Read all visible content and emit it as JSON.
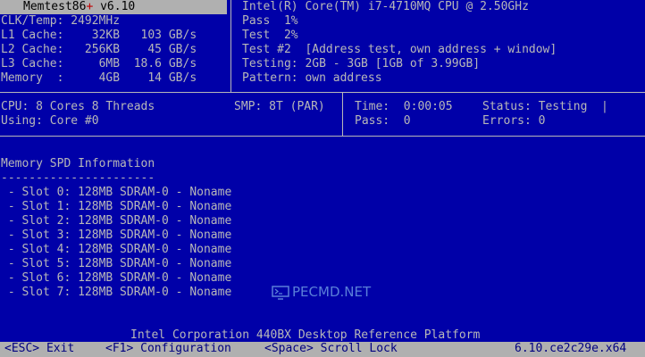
{
  "header": {
    "app_name": "Memtest86",
    "app_plus": "+",
    "app_version": "v6.10"
  },
  "system": {
    "clk": "CLK/Temp: 2492MHz",
    "l1": "L1 Cache:    32KB   103 GB/s",
    "l2": "L2 Cache:   256KB    45 GB/s",
    "l3": "L3 Cache:     6MB  18.6 GB/s",
    "mem": "Memory  :     4GB    14 GB/s"
  },
  "test_info": {
    "cpu_model": "Intel(R) Core(TM) i7-4710MQ CPU @ 2.50GHz",
    "pass": "Pass  1%",
    "test": "Test  2%",
    "test_name": "Test #2  [Address test, own address + window]",
    "testing": "Testing: 2GB - 3GB [1GB of 3.99GB]",
    "pattern": "Pattern: own address"
  },
  "cpu": {
    "cores": "CPU: 8 Cores 8 Threads",
    "smp": "SMP: 8T (PAR)",
    "using": "Using: Core #0"
  },
  "status": {
    "time": "Time:  0:00:05",
    "state": "Status: Testing  |",
    "pass": "Pass:  0",
    "errors": "Errors: 0"
  },
  "spd": {
    "heading": "Memory SPD Information",
    "underline": "----------------------",
    "slots": [
      " - Slot 0: 128MB SDRAM-0 - Noname",
      " - Slot 1: 128MB SDRAM-0 - Noname",
      " - Slot 2: 128MB SDRAM-0 - Noname",
      " - Slot 3: 128MB SDRAM-0 - Noname",
      " - Slot 4: 128MB SDRAM-0 - Noname",
      " - Slot 5: 128MB SDRAM-0 - Noname",
      " - Slot 6: 128MB SDRAM-0 - Noname",
      " - Slot 7: 128MB SDRAM-0 - Noname"
    ]
  },
  "platform": "Intel Corporation 440BX Desktop Reference Platform",
  "footer": {
    "esc": "<ESC> Exit",
    "f1": "<F1> Configuration",
    "space": "<Space> Scroll Lock",
    "build": "6.10.ce2c29e.x64"
  },
  "watermark": "PECMD.NET",
  "colors": {
    "background": "#0000a8",
    "text": "#b8b8b8",
    "bar": "#b0b0b0",
    "plus": "#c00000"
  }
}
